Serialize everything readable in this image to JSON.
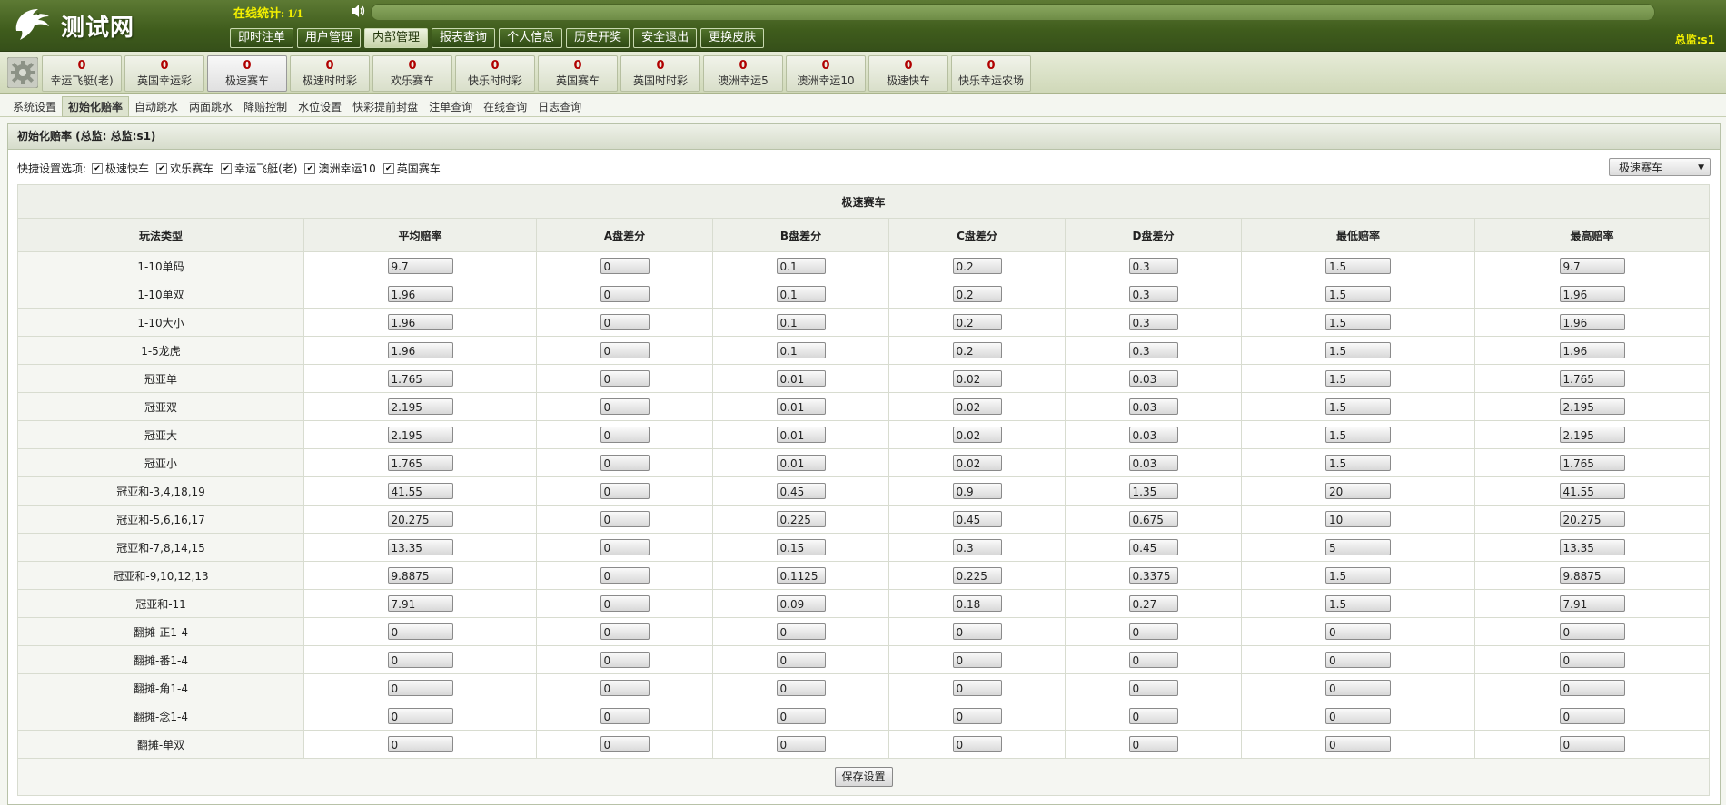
{
  "header": {
    "logo_text": "测试网",
    "online_stat": "在线统计: 1/1",
    "role": "总监:s1",
    "nav": [
      "即时注单",
      "用户管理",
      "内部管理",
      "报表查询",
      "个人信息",
      "历史开奖",
      "安全退出",
      "更换皮肤"
    ],
    "active_nav": "内部管理"
  },
  "games": [
    {
      "count": "0",
      "name": "幸运飞艇(老)"
    },
    {
      "count": "0",
      "name": "英国幸运彩"
    },
    {
      "count": "0",
      "name": "极速赛车"
    },
    {
      "count": "0",
      "name": "极速时时彩"
    },
    {
      "count": "0",
      "name": "欢乐赛车"
    },
    {
      "count": "0",
      "name": "快乐时时彩"
    },
    {
      "count": "0",
      "name": "英国赛车"
    },
    {
      "count": "0",
      "name": "英国时时彩"
    },
    {
      "count": "0",
      "name": "澳洲幸运5"
    },
    {
      "count": "0",
      "name": "澳洲幸运10"
    },
    {
      "count": "0",
      "name": "极速快车"
    },
    {
      "count": "0",
      "name": "快乐幸运农场"
    }
  ],
  "active_game": "极速赛车",
  "sub_nav": [
    "系统设置",
    "初始化赔率",
    "自动跳水",
    "两面跳水",
    "降赔控制",
    "水位设置",
    "快彩提前封盘",
    "注单查询",
    "在线查询",
    "日志查询"
  ],
  "active_sub": "初始化赔率",
  "panel": {
    "title": "初始化赔率 (总监: 总监:s1)",
    "quick_label": "快捷设置选项:",
    "quick_options": [
      "极速快车",
      "欢乐赛车",
      "幸运飞艇(老)",
      "澳洲幸运10",
      "英国赛车"
    ],
    "select_value": "极速赛车",
    "select_arrow": "▼",
    "check_mark": "✔"
  },
  "table": {
    "caption": "极速赛车",
    "headers": [
      "玩法类型",
      "平均赔率",
      "A盘差分",
      "B盘差分",
      "C盘差分",
      "D盘差分",
      "最低赔率",
      "最高赔率"
    ],
    "rows": [
      {
        "type": "1-10单码",
        "values": [
          "9.7",
          "0",
          "0.1",
          "0.2",
          "0.3",
          "1.5",
          "9.7"
        ]
      },
      {
        "type": "1-10单双",
        "values": [
          "1.96",
          "0",
          "0.1",
          "0.2",
          "0.3",
          "1.5",
          "1.96"
        ]
      },
      {
        "type": "1-10大小",
        "values": [
          "1.96",
          "0",
          "0.1",
          "0.2",
          "0.3",
          "1.5",
          "1.96"
        ]
      },
      {
        "type": "1-5龙虎",
        "values": [
          "1.96",
          "0",
          "0.1",
          "0.2",
          "0.3",
          "1.5",
          "1.96"
        ]
      },
      {
        "type": "冠亚单",
        "values": [
          "1.765",
          "0",
          "0.01",
          "0.02",
          "0.03",
          "1.5",
          "1.765"
        ]
      },
      {
        "type": "冠亚双",
        "values": [
          "2.195",
          "0",
          "0.01",
          "0.02",
          "0.03",
          "1.5",
          "2.195"
        ]
      },
      {
        "type": "冠亚大",
        "values": [
          "2.195",
          "0",
          "0.01",
          "0.02",
          "0.03",
          "1.5",
          "2.195"
        ]
      },
      {
        "type": "冠亚小",
        "values": [
          "1.765",
          "0",
          "0.01",
          "0.02",
          "0.03",
          "1.5",
          "1.765"
        ]
      },
      {
        "type": "冠亚和-3,4,18,19",
        "values": [
          "41.55",
          "0",
          "0.45",
          "0.9",
          "1.35",
          "20",
          "41.55"
        ]
      },
      {
        "type": "冠亚和-5,6,16,17",
        "values": [
          "20.275",
          "0",
          "0.225",
          "0.45",
          "0.675",
          "10",
          "20.275"
        ]
      },
      {
        "type": "冠亚和-7,8,14,15",
        "values": [
          "13.35",
          "0",
          "0.15",
          "0.3",
          "0.45",
          "5",
          "13.35"
        ]
      },
      {
        "type": "冠亚和-9,10,12,13",
        "values": [
          "9.8875",
          "0",
          "0.1125",
          "0.225",
          "0.3375",
          "1.5",
          "9.8875"
        ]
      },
      {
        "type": "冠亚和-11",
        "values": [
          "7.91",
          "0",
          "0.09",
          "0.18",
          "0.27",
          "1.5",
          "7.91"
        ]
      },
      {
        "type": "翻摊-正1-4",
        "values": [
          "0",
          "0",
          "0",
          "0",
          "0",
          "0",
          "0"
        ]
      },
      {
        "type": "翻摊-番1-4",
        "values": [
          "0",
          "0",
          "0",
          "0",
          "0",
          "0",
          "0"
        ]
      },
      {
        "type": "翻摊-角1-4",
        "values": [
          "0",
          "0",
          "0",
          "0",
          "0",
          "0",
          "0"
        ]
      },
      {
        "type": "翻摊-念1-4",
        "values": [
          "0",
          "0",
          "0",
          "0",
          "0",
          "0",
          "0"
        ]
      },
      {
        "type": "翻摊-单双",
        "values": [
          "0",
          "0",
          "0",
          "0",
          "0",
          "0",
          "0"
        ]
      }
    ],
    "save_label": "保存设置"
  }
}
